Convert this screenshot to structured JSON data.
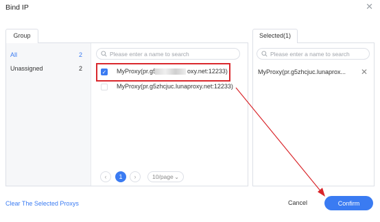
{
  "dialog": {
    "title": "Bind IP",
    "close_icon": "close-icon"
  },
  "group_panel": {
    "tab_label": "Group",
    "items": [
      {
        "label": "All",
        "count": "2",
        "active": true
      },
      {
        "label": "Unassigned",
        "count": "2",
        "active": false
      }
    ]
  },
  "proxy_panel": {
    "search_placeholder": "Please enter a name to search",
    "proxies": [
      {
        "label_start": "MyProxy(pr.g5",
        "label_end": "oxy.net:12233)",
        "checked": true,
        "redacted": true
      },
      {
        "label": "MyProxy(pr.g5zhcjuc.lunaproxy.net:12233)",
        "checked": false
      }
    ],
    "pagination": {
      "current_page": "1",
      "page_size": "10/page"
    }
  },
  "selected_panel": {
    "tab_label": "Selected(1)",
    "search_placeholder": "Please enter a name to search",
    "items": [
      {
        "label": "MyProxy(pr.g5zhcjuc.lunaprox..."
      }
    ]
  },
  "footer": {
    "clear_label": "Clear The Selected Proxys",
    "cancel_label": "Cancel",
    "confirm_label": "Confirm"
  },
  "colors": {
    "accent": "#3a7bf2",
    "annotation_red": "#d9262b"
  }
}
